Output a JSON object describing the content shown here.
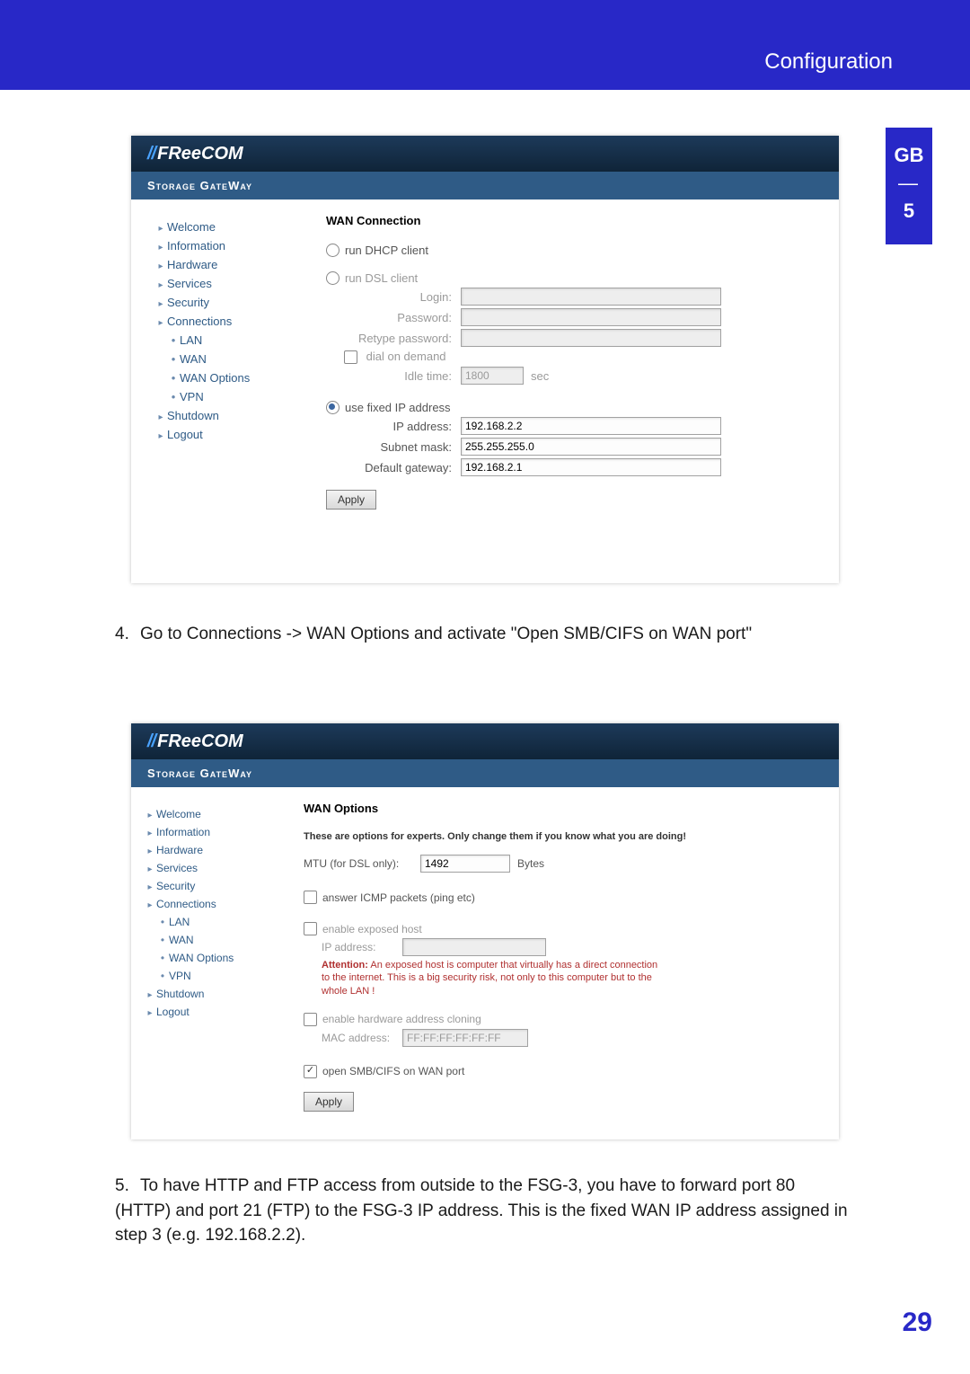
{
  "header": {
    "title": "Configuration"
  },
  "side_tab": {
    "lang": "GB",
    "chapter": "5"
  },
  "page_number": "29",
  "instructions": {
    "step4_num": "4.",
    "step4": "Go to Connections -> WAN Options and activate \"Open SMB/CIFS on WAN port\"",
    "step5_num": "5.",
    "step5": "To have HTTP and FTP access from outside to the FSG-3, you have to forward port 80 (HTTP) and port 21 (FTP) to the FSG-3 IP address. This is the fixed WAN IP address assigned in step 3 (e.g. 192.168.2.2)."
  },
  "brand": {
    "logo": "FReeCOM",
    "subtitle": "Storage GateWay"
  },
  "nav": {
    "items": [
      "Welcome",
      "Information",
      "Hardware",
      "Services",
      "Security",
      "Connections"
    ],
    "subs": [
      "LAN",
      "WAN",
      "WAN Options",
      "VPN"
    ],
    "tail": [
      "Shutdown",
      "Logout"
    ]
  },
  "shot1": {
    "title": "WAN Connection",
    "opt_dhcp": "run DHCP client",
    "opt_dsl": "run DSL client",
    "login": "Login:",
    "password": "Password:",
    "retype": "Retype password:",
    "dial": "dial on demand",
    "idle_label": "Idle time:",
    "idle_value": "1800",
    "idle_unit": "sec",
    "opt_fixed": "use fixed IP address",
    "ip_label": "IP address:",
    "ip_value": "192.168.2.2",
    "mask_label": "Subnet mask:",
    "mask_value": "255.255.255.0",
    "gw_label": "Default gateway:",
    "gw_value": "192.168.2.1",
    "apply": "Apply"
  },
  "shot2": {
    "title": "WAN Options",
    "warning": "These are options for experts. Only change them if you know what you are doing!",
    "mtu_label": "MTU (for DSL only):",
    "mtu_value": "1492",
    "mtu_unit": "Bytes",
    "icmp": "answer ICMP packets (ping etc)",
    "exposed": "enable exposed host",
    "exposed_ip_label": "IP address:",
    "exposed_note1": "Attention:",
    "exposed_note2": " An exposed host is computer that virtually has a direct connection to the internet. This is a big security risk, not only to this computer but to the whole LAN !",
    "clone": "enable hardware address cloning",
    "mac_label": "MAC address:",
    "mac_value": "FF:FF:FF:FF:FF:FF",
    "smb": "open SMB/CIFS on WAN port",
    "apply": "Apply"
  }
}
